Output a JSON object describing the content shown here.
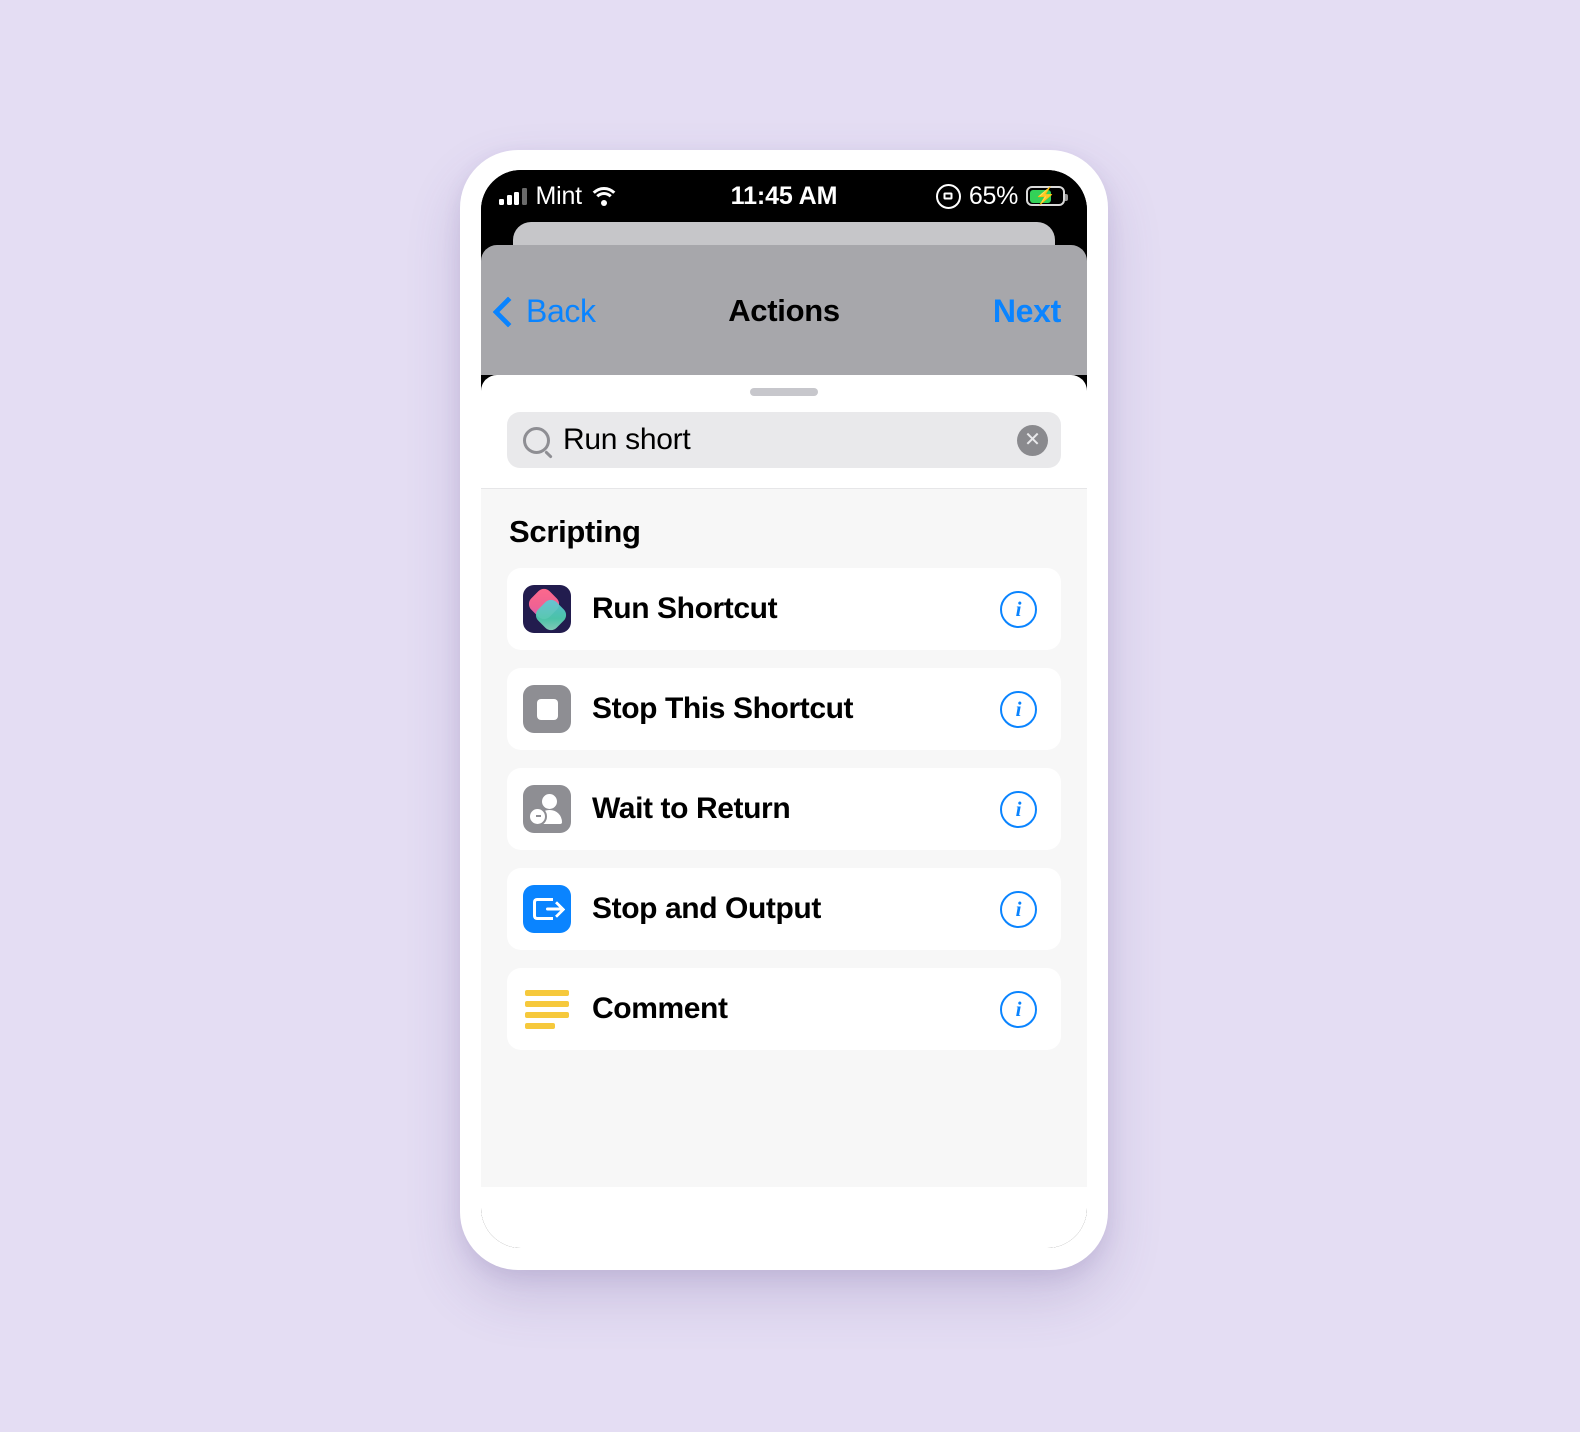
{
  "background_color": "#e4ddf3",
  "status_bar": {
    "carrier": "Mint",
    "signal_icon": "cellular-signal-icon",
    "wifi_icon": "wifi-icon",
    "time": "11:45 AM",
    "rotation_lock_icon": "rotation-lock-icon",
    "battery_percent": "65%",
    "battery_icon": "battery-charging-icon",
    "battery_color": "#33d158"
  },
  "nav_bar": {
    "back_label": "Back",
    "title": "Actions",
    "next_label": "Next",
    "accent_color": "#0a84ff"
  },
  "search": {
    "value": "Run short",
    "placeholder": "Search",
    "search_icon": "search-icon",
    "clear_icon": "clear-circle-icon"
  },
  "results": {
    "section_header": "Scripting",
    "items": [
      {
        "label": "Run Shortcut",
        "icon": "shortcuts-app-icon",
        "info": "i"
      },
      {
        "label": "Stop This Shortcut",
        "icon": "stop-square-icon",
        "info": "i"
      },
      {
        "label": "Wait to Return",
        "icon": "person-clock-icon",
        "info": "i"
      },
      {
        "label": "Stop and Output",
        "icon": "exit-arrow-icon",
        "info": "i"
      },
      {
        "label": "Comment",
        "icon": "comment-lines-icon",
        "info": "i"
      }
    ]
  }
}
